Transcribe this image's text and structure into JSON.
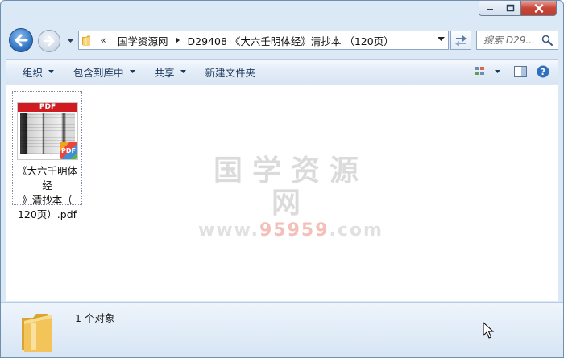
{
  "window": {
    "caption_buttons": {
      "minimize_icon": "minimize-icon",
      "maximize_icon": "maximize-icon",
      "close_icon": "close-icon"
    }
  },
  "navigation": {
    "back_icon": "back-arrow-icon",
    "forward_icon": "forward-arrow-icon",
    "overflow_label": "«",
    "breadcrumbs": [
      {
        "label": "国学资源网"
      },
      {
        "label": "D29408 《大六壬明体经》清抄本 （120页）"
      }
    ],
    "search_placeholder": "搜索 D29..."
  },
  "toolbar": {
    "organize_label": "组织",
    "include_library_label": "包含到库中",
    "share_label": "共享",
    "new_folder_label": "新建文件夹"
  },
  "files": [
    {
      "name": "《大六壬明体经》清抄本（120页）.pdf",
      "name_lines": [
        "《大六壬明体经",
        "》清抄本（",
        "120页）.pdf"
      ],
      "thumb_banner": "PDF",
      "badge": "PDF"
    }
  ],
  "watermark": {
    "title": "国学资源网",
    "domain_prefix": "www.",
    "domain_main": "95959",
    "domain_suffix": ".com"
  },
  "details": {
    "status": "1 个对象"
  },
  "colors": {
    "frame": "#dbe8f5",
    "toolbar_text": "#1e395b",
    "close_button": "#c7473a",
    "pdf_red": "#d01c20",
    "folder_yellow": "#f2c45a"
  }
}
